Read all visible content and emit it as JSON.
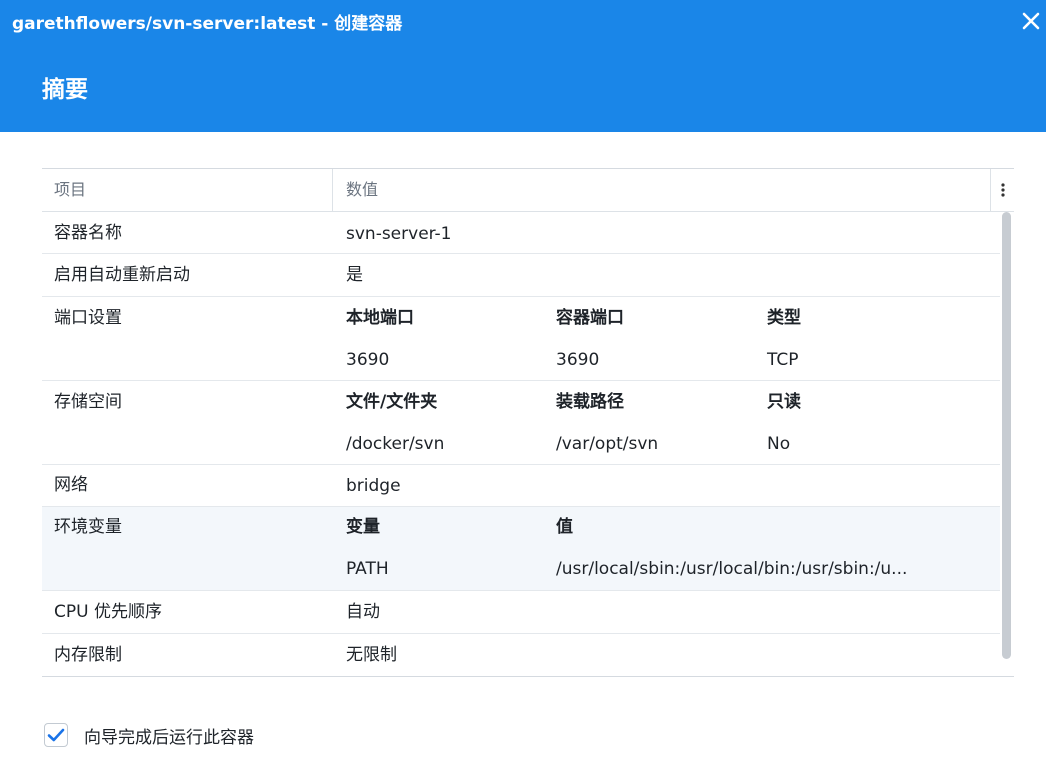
{
  "window": {
    "title": "garethflowers/svn-server:latest - 创建容器"
  },
  "step": {
    "title": "摘要"
  },
  "table": {
    "headers": {
      "item": "项目",
      "value": "数值"
    },
    "rows": {
      "container_name": {
        "label": "容器名称",
        "value": "svn-server-1"
      },
      "auto_restart": {
        "label": "启用自动重新启动",
        "value": "是"
      },
      "port_settings": {
        "label": "端口设置",
        "col_local": "本地端口",
        "col_container": "容器端口",
        "col_type": "类型",
        "local": "3690",
        "container": "3690",
        "type": "TCP"
      },
      "storage": {
        "label": "存储空间",
        "col_path": "文件/文件夹",
        "col_mount": "装载路径",
        "col_readonly": "只读",
        "path": "/docker/svn",
        "mount": "/var/opt/svn",
        "readonly": "No"
      },
      "network": {
        "label": "网络",
        "value": "bridge"
      },
      "env": {
        "label": "环境变量",
        "col_var": "变量",
        "col_val": "值",
        "var": "PATH",
        "val": "/usr/local/sbin:/usr/local/bin:/usr/sbin:/u..."
      },
      "cpu": {
        "label": "CPU 优先顺序",
        "value": "自动"
      },
      "memory": {
        "label": "内存限制",
        "value": "无限制"
      }
    }
  },
  "run_after": {
    "label": "向导完成后运行此容器",
    "checked": true
  },
  "colors": {
    "header_bg": "#1a86e8",
    "checkbox_accent": "#1a73e8"
  },
  "icons": {
    "close": "close-icon",
    "column_menu": "more-vertical-icon",
    "check": "checkmark-icon"
  }
}
